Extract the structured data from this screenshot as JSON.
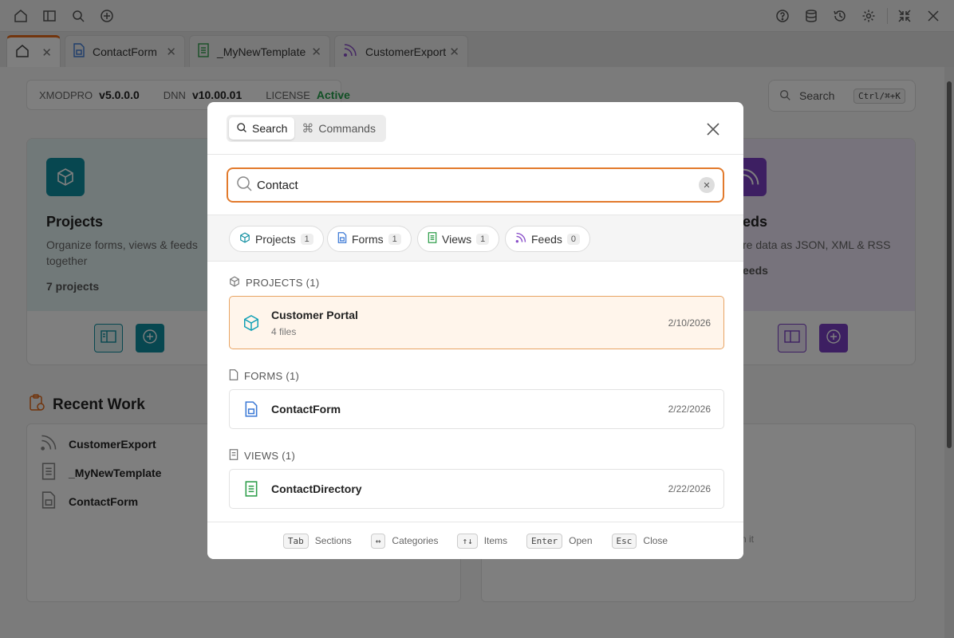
{
  "toolbar": {
    "left_icons": [
      "home-icon",
      "sidebar-toggle-icon",
      "search-icon",
      "add-icon"
    ],
    "right_icons": [
      "help-icon",
      "database-icon",
      "history-icon",
      "settings-icon",
      "collapse-icon",
      "close-icon"
    ]
  },
  "tabs": [
    {
      "label": "",
      "icon": "home-icon",
      "active": true
    },
    {
      "label": "ContactForm",
      "icon": "form-icon"
    },
    {
      "label": "_MyNewTemplate",
      "icon": "template-icon"
    },
    {
      "label": "CustomerExport",
      "icon": "feed-icon"
    }
  ],
  "infobar": {
    "product_label": "XMODPRO",
    "product_version": "v5.0.0.0",
    "dnn_label": "DNN",
    "dnn_version": "v10.00.01",
    "license_label": "LICENSE",
    "license_status": "Active"
  },
  "bg_search": {
    "label": "Search",
    "shortcut": "Ctrl/⌘+K"
  },
  "cards": {
    "projects": {
      "title": "Projects",
      "desc": "Organize forms, views & feeds together",
      "count": "7 projects"
    },
    "feeds": {
      "title": "eds",
      "desc": "re data as JSON, XML & RSS",
      "count": "eeds"
    }
  },
  "recent": {
    "title": "Recent Work",
    "items": [
      "CustomerExport",
      "_MyNewTemplate",
      "ContactForm"
    ],
    "right_hint": "n it"
  },
  "modal": {
    "seg_search": "Search",
    "seg_commands": "Commands",
    "query": "Contact",
    "chips": [
      {
        "label": "Projects",
        "count": "1"
      },
      {
        "label": "Forms",
        "count": "1"
      },
      {
        "label": "Views",
        "count": "1"
      },
      {
        "label": "Feeds",
        "count": "0"
      }
    ],
    "sections": {
      "projects": "PROJECTS (1)",
      "forms": "FORMS (1)",
      "views": "VIEWS (1)"
    },
    "results": {
      "project": {
        "name": "Customer Portal",
        "sub": "4 files",
        "date": "2/10/2026"
      },
      "form": {
        "name": "ContactForm",
        "date": "2/22/2026"
      },
      "view": {
        "name": "ContactDirectory",
        "date": "2/22/2026"
      }
    },
    "footer": [
      {
        "key": "Tab",
        "label": "Sections"
      },
      {
        "key": "↔",
        "label": "Categories"
      },
      {
        "key": "↑↓",
        "label": "Items"
      },
      {
        "key": "Enter",
        "label": "Open"
      },
      {
        "key": "Esc",
        "label": "Close"
      }
    ]
  },
  "colors": {
    "accent": "#e46a1a",
    "teal": "#0e8ea0",
    "purple": "#7b3fc4",
    "active_green": "#23a04a"
  }
}
